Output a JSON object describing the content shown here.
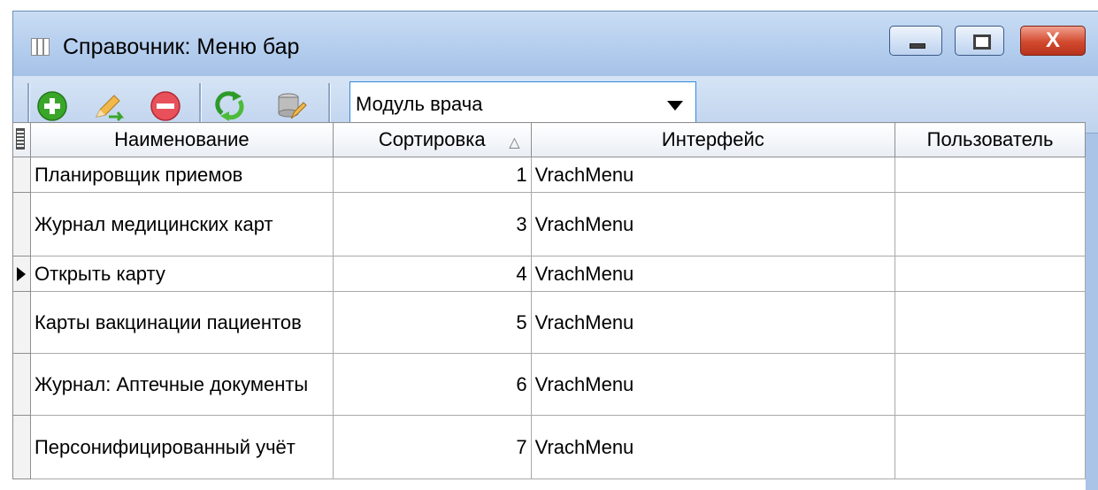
{
  "window": {
    "title": "Справочник: Меню бар",
    "controls": {
      "minimize": "",
      "maximize": "",
      "close": "X"
    }
  },
  "toolbar": {
    "icons": [
      "add-icon",
      "edit-icon",
      "delete-icon",
      "refresh-icon",
      "database-edit-icon"
    ],
    "combo_value": "Модуль врача"
  },
  "table": {
    "columns": [
      "Наименование",
      "Сортировка",
      "Интерфейс",
      "Пользователь"
    ],
    "sort_indicator": "△",
    "rows": [
      {
        "name": "Планировщик приемов",
        "sort": "1",
        "interface": "VrachMenu",
        "user": ""
      },
      {
        "name": "Журнал медицинских карт",
        "sort": "3",
        "interface": "VrachMenu",
        "user": ""
      },
      {
        "name": "Открыть карту",
        "sort": "4",
        "interface": "VrachMenu",
        "user": "",
        "current": true
      },
      {
        "name": "Карты вакцинации пациентов",
        "sort": "5",
        "interface": "VrachMenu",
        "user": ""
      },
      {
        "name": "Журнал: Аптечные документы",
        "sort": "6",
        "interface": "VrachMenu",
        "user": ""
      },
      {
        "name": "Персонифицированный учёт",
        "sort": "7",
        "interface": "VrachMenu",
        "user": ""
      }
    ]
  },
  "colors": {
    "title_bg": "#b3cdee",
    "close_button": "#d24a2f",
    "accent_add": "#3aa629",
    "accent_delete": "#e8505a"
  }
}
